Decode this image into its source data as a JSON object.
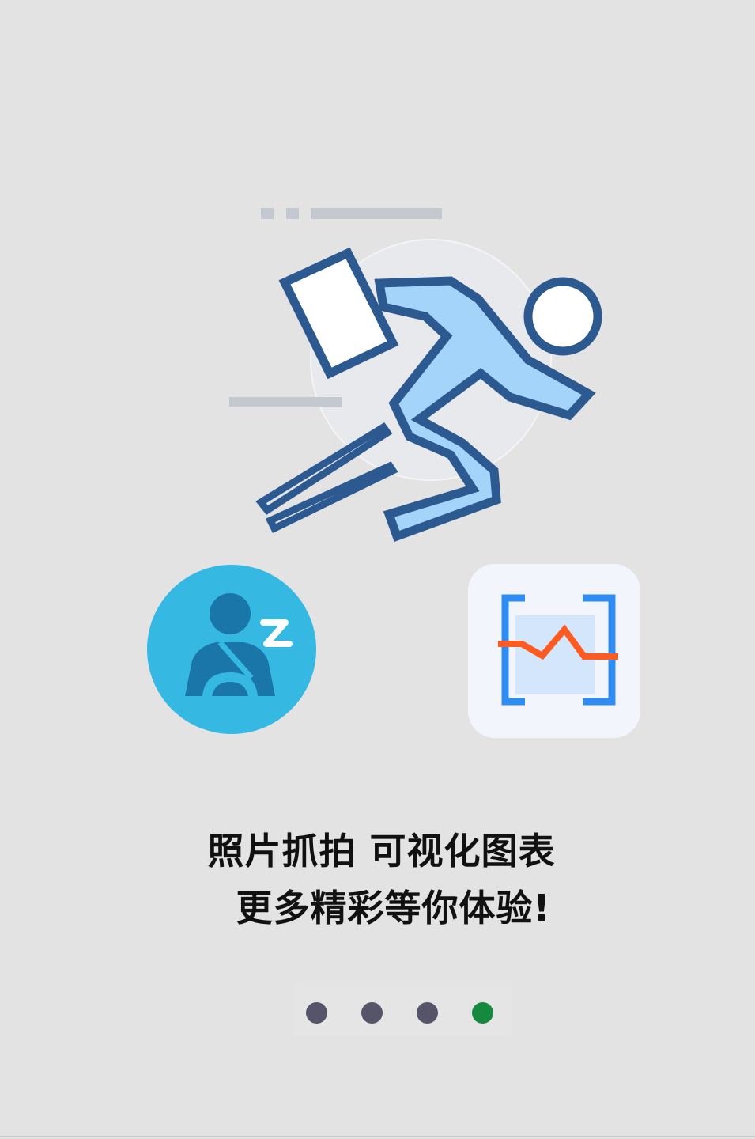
{
  "caption": {
    "line1": "照片抓拍 可视化图表",
    "line2": "更多精彩等你体验!"
  },
  "illustration": {
    "hero_icon": "running-person-with-document-icon",
    "badge_left_icon": "sleepy-driver-icon",
    "badge_right_icon": "chart-monitor-icon"
  },
  "pager": {
    "page_count": 4,
    "active_index": 3,
    "colors": {
      "inactive": "#555468",
      "active": "#158a3e"
    }
  },
  "colors": {
    "background": "#e3e3e3",
    "stroke_dark_blue": "#2c5990",
    "figure_fill": "#a5d4fb",
    "badge_cyan": "#35b8e2",
    "chart_orange": "#ff5a1f",
    "chart_blue": "#2e8cf2"
  }
}
